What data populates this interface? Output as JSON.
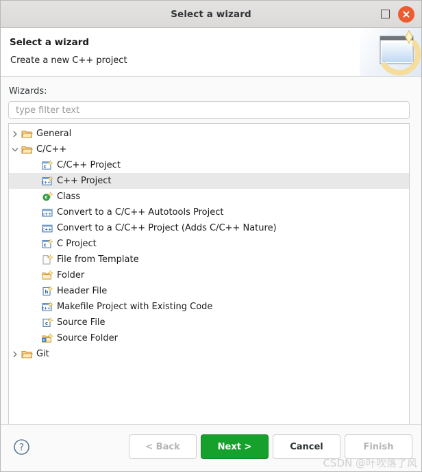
{
  "window": {
    "title": "Select a wizard",
    "maximize_icon": "maximize-icon",
    "close_icon": "close-icon"
  },
  "header": {
    "title": "Select a wizard",
    "subtitle": "Create a new C++ project",
    "banner_icon": "wizard-banner-icon"
  },
  "main": {
    "wizards_label": "Wizards:",
    "filter_placeholder": "type filter text",
    "filter_value": ""
  },
  "tree": {
    "selected_index": 3,
    "items": [
      {
        "label": "General",
        "icon": "folder-icon",
        "level": 0,
        "twisty": "collapsed",
        "selected": false
      },
      {
        "label": "C/C++",
        "icon": "folder-icon",
        "level": 0,
        "twisty": "expanded",
        "selected": false
      },
      {
        "label": "C/C++ Project",
        "icon": "c-project-icon",
        "level": 1,
        "twisty": "none",
        "selected": false
      },
      {
        "label": "C++ Project",
        "icon": "cpp-project-icon",
        "level": 1,
        "twisty": "none",
        "selected": true
      },
      {
        "label": "Class",
        "icon": "class-icon",
        "level": 1,
        "twisty": "none",
        "selected": false
      },
      {
        "label": "Convert to a C/C++ Autotools Project",
        "icon": "convert-cpp-icon",
        "level": 1,
        "twisty": "none",
        "selected": false
      },
      {
        "label": "Convert to a C/C++ Project (Adds C/C++ Nature)",
        "icon": "convert-cpp-icon",
        "level": 1,
        "twisty": "none",
        "selected": false
      },
      {
        "label": "C Project",
        "icon": "c-project-icon",
        "level": 1,
        "twisty": "none",
        "selected": false
      },
      {
        "label": "File from Template",
        "icon": "file-template-icon",
        "level": 1,
        "twisty": "none",
        "selected": false
      },
      {
        "label": "Folder",
        "icon": "new-folder-icon",
        "level": 1,
        "twisty": "none",
        "selected": false
      },
      {
        "label": "Header File",
        "icon": "header-file-icon",
        "level": 1,
        "twisty": "none",
        "selected": false
      },
      {
        "label": "Makefile Project with Existing Code",
        "icon": "cpp-project-icon",
        "level": 1,
        "twisty": "none",
        "selected": false
      },
      {
        "label": "Source File",
        "icon": "source-file-icon",
        "level": 1,
        "twisty": "none",
        "selected": false
      },
      {
        "label": "Source Folder",
        "icon": "source-folder-icon",
        "level": 1,
        "twisty": "none",
        "selected": false
      },
      {
        "label": "Git",
        "icon": "folder-icon",
        "level": 0,
        "twisty": "collapsed",
        "selected": false
      }
    ]
  },
  "footer": {
    "help_icon": "help-icon",
    "back_label": "< Back",
    "next_label": "Next >",
    "cancel_label": "Cancel",
    "finish_label": "Finish",
    "back_enabled": false,
    "next_enabled": true,
    "cancel_enabled": true,
    "finish_enabled": false
  },
  "watermark": {
    "text": "CSDN @叶吹落了风"
  },
  "colors": {
    "accent_green": "#16a02c",
    "close_red": "#ed5c31",
    "selection_gray": "#e8e8e8",
    "folder_orange": "#e8a33d"
  }
}
